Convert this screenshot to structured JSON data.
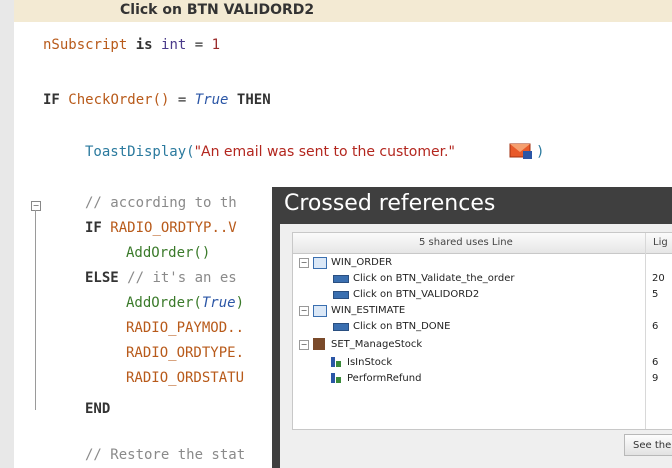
{
  "event_title": "Click on BTN VALIDORD2",
  "code": {
    "l1_var": "nSubscript",
    "l1_is": "is",
    "l1_type": "int",
    "l1_eq": "=",
    "l1_val": "1",
    "l2_if": "IF",
    "l2_fn": "CheckOrder()",
    "l2_eq": "=",
    "l2_true": "True",
    "l2_then": "THEN",
    "l3_fn": "ToastDisplay(",
    "l3_str": "\"An email was sent to the customer.\"",
    "l3_close": ")",
    "l4_comment": "// according to th",
    "l5_if": "IF",
    "l5_expr": "RADIO_ORDTYP..V",
    "l6_call": "AddOrder()",
    "l7_else": "ELSE",
    "l7_comment": "// it's an es",
    "l8_call": "AddOrder(",
    "l8_true": "True",
    "l8_close": ")",
    "l9": "RADIO_PAYMOD..",
    "l10": "RADIO_ORDTYPE.",
    "l11": "RADIO_ORDSTATU",
    "l12_end": "END",
    "l13_comment": "// Restore the stat"
  },
  "popup": {
    "title": "Crossed references",
    "col_uses": "5 shared uses Line",
    "col_line": "Lig",
    "rows": [
      {
        "label": "WIN_ORDER",
        "value": ""
      },
      {
        "label": "Click on BTN_Validate_the_order",
        "value": "20"
      },
      {
        "label": "Click on BTN_VALIDORD2",
        "value": "5"
      },
      {
        "label": "WIN_ESTIMATE",
        "value": ""
      },
      {
        "label": "Click on BTN_DONE",
        "value": "6"
      },
      {
        "label": "SET_ManageStock",
        "value": ""
      },
      {
        "label": "IsInStock",
        "value": "6"
      },
      {
        "label": "PerformRefund",
        "value": "9"
      }
    ],
    "see_button": "See the"
  },
  "colors": {
    "title_bar": "#f3ead3",
    "popup_header": "#3f3f3f",
    "string": "#b3261e",
    "function": "#2b7a9e"
  }
}
